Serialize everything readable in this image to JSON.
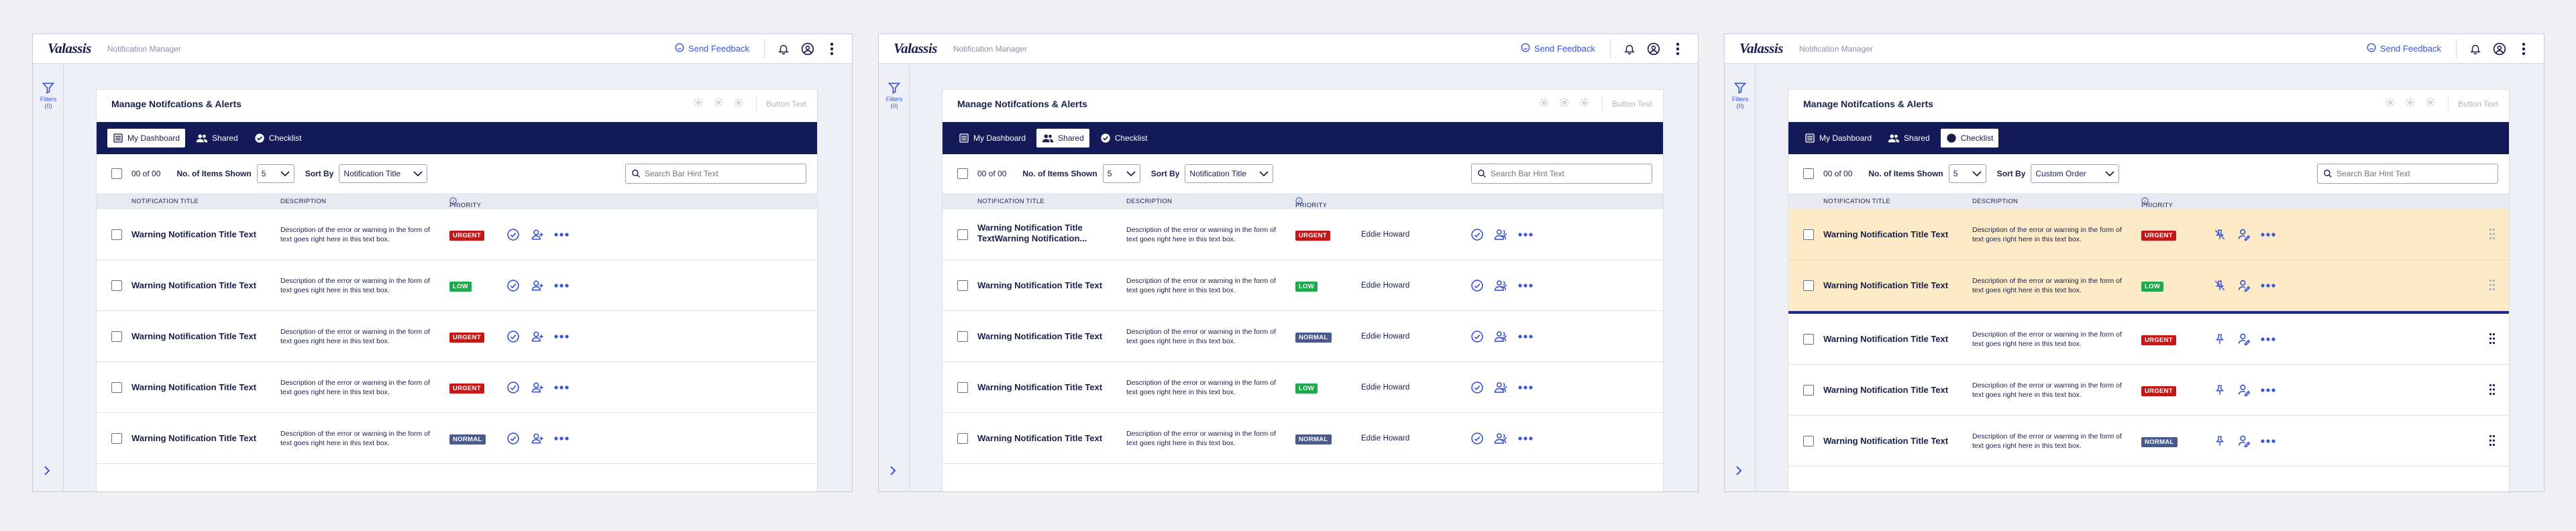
{
  "app": {
    "logo": "Valassis",
    "name": "Notification Manager",
    "feedback": "Send Feedback"
  },
  "rail": {
    "filters_label": "Filters",
    "filters_count": "(0)"
  },
  "card": {
    "title": "Manage Notifcations & Alerts",
    "button_text": "Button Text"
  },
  "tabs": [
    "My Dashboard",
    "Shared",
    "Checklist"
  ],
  "toolbar": {
    "count": "00 of 00",
    "items_label": "No. of Items Shown",
    "items_value": "5",
    "sort_label": "Sort By",
    "search_placeholder": "Search Bar Hint Text"
  },
  "columns": {
    "title": "NOTIFICATION TITLE",
    "description": "DESCRIPTION",
    "priority": "PRIORITY"
  },
  "description_text": "Description of the error or warning in the form of text goes right here in this text box.",
  "colors": {
    "navy": "#131a57",
    "accent": "#3a55d6",
    "urgent": "#c21818",
    "low": "#1fa84d",
    "normal": "#4b5a8c",
    "highlight": "#fcebc6"
  },
  "panels": [
    {
      "active_tab": 0,
      "sort_value": "Notification Title",
      "rows": [
        {
          "title": "Warning Notification Title Text",
          "priority": "URGENT"
        },
        {
          "title": "Warning Notification Title Text",
          "priority": "LOW"
        },
        {
          "title": "Warning Notification Title Text",
          "priority": "URGENT"
        },
        {
          "title": "Warning Notification Title Text",
          "priority": "URGENT"
        },
        {
          "title": "Warning Notification Title Text",
          "priority": "NORMAL"
        }
      ]
    },
    {
      "active_tab": 1,
      "sort_value": "Notification Title",
      "rows": [
        {
          "title": "Warning Notification Title TextWarning Notification...",
          "priority": "URGENT",
          "owner": "Eddie Howard"
        },
        {
          "title": "Warning Notification Title Text",
          "priority": "LOW",
          "owner": "Eddie Howard"
        },
        {
          "title": "Warning Notification Title Text",
          "priority": "NORMAL",
          "owner": "Eddie Howard"
        },
        {
          "title": "Warning Notification Title Text",
          "priority": "LOW",
          "owner": "Eddie Howard"
        },
        {
          "title": "Warning Notification Title Text",
          "priority": "NORMAL",
          "owner": "Eddie Howard"
        }
      ]
    },
    {
      "active_tab": 2,
      "sort_value": "Custom Order",
      "rows": [
        {
          "title": "Warning Notification Title Text",
          "priority": "URGENT",
          "highlight": true
        },
        {
          "title": "Warning Notification Title Text",
          "priority": "LOW",
          "highlight": true
        },
        {
          "title": "Warning Notification Title Text",
          "priority": "URGENT"
        },
        {
          "title": "Warning Notification Title Text",
          "priority": "URGENT"
        },
        {
          "title": "Warning Notification Title Text",
          "priority": "NORMAL"
        }
      ]
    }
  ]
}
